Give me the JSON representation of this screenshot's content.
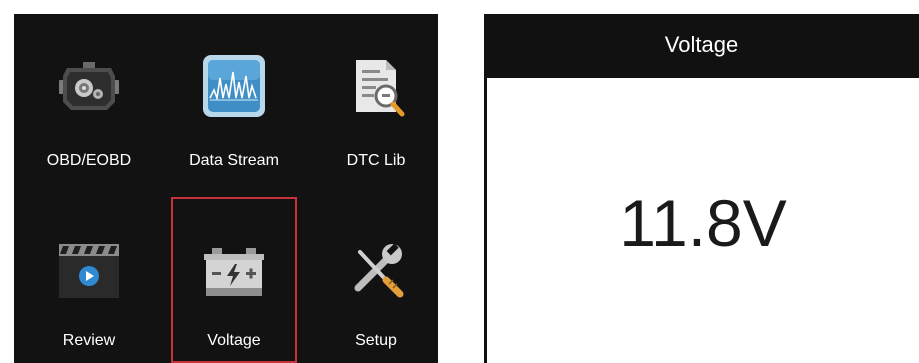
{
  "menu": {
    "items": [
      {
        "label": "OBD/EOBD",
        "icon": "engine-icon"
      },
      {
        "label": "Data Stream",
        "icon": "data-stream-icon"
      },
      {
        "label": "DTC Lib",
        "icon": "dtc-document-icon"
      },
      {
        "label": "Review",
        "icon": "film-play-icon"
      },
      {
        "label": "Voltage",
        "icon": "battery-icon"
      },
      {
        "label": "Setup",
        "icon": "wrench-screwdriver-icon"
      }
    ],
    "selected": "Voltage"
  },
  "voltage": {
    "title": "Voltage",
    "value": "11.8V"
  },
  "colors": {
    "background": "#121212",
    "selection": "#c8323a",
    "text": "#ffffff"
  }
}
